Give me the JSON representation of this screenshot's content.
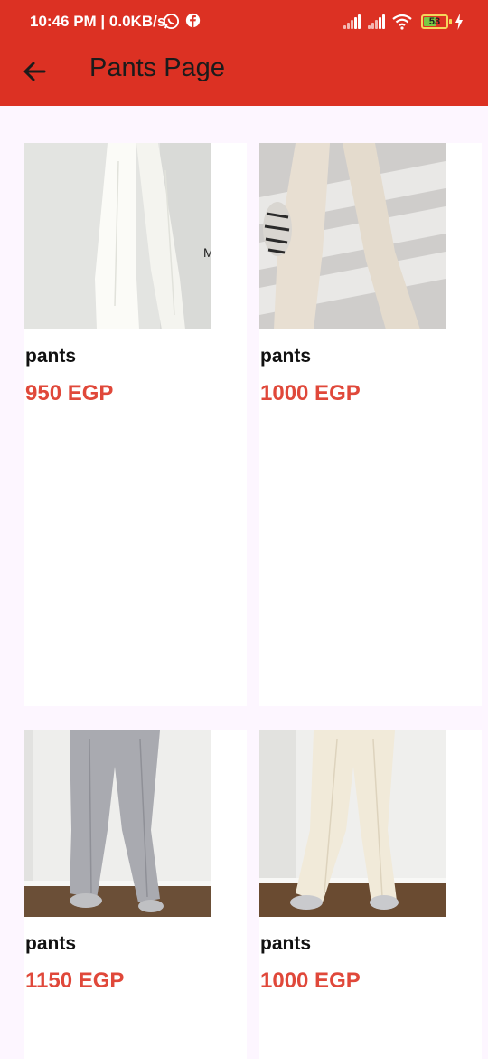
{
  "status_bar": {
    "time_speed": "10:46 PM | 0.0KB/s",
    "battery": "53"
  },
  "app_bar": {
    "title": "Pants Page"
  },
  "products": [
    {
      "name": "pants",
      "price": "950 EGP"
    },
    {
      "name": "pants",
      "price": "1000 EGP"
    },
    {
      "name": "pants",
      "price": "1150 EGP"
    },
    {
      "name": "pants",
      "price": "1000 EGP"
    }
  ],
  "colors": {
    "app_bar": "#dc3123",
    "price": "#e0483a",
    "background": "#fdf6ff"
  }
}
